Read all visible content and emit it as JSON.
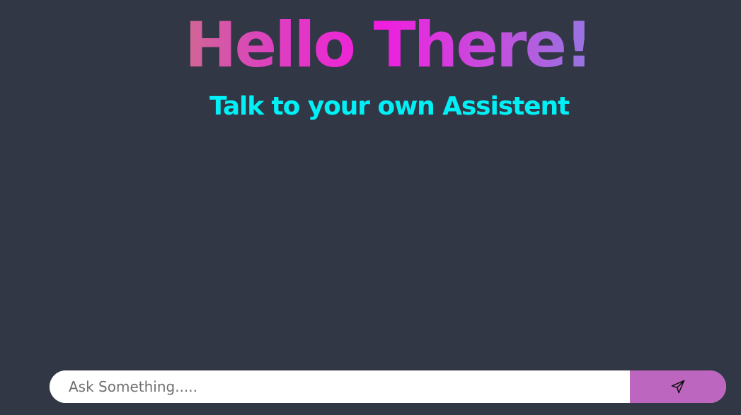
{
  "hero": {
    "title": "Hello There!",
    "subtitle": "Talk to your own Assistent"
  },
  "chat_input": {
    "placeholder": "Ask Something.....",
    "value": ""
  },
  "send_button": {
    "icon": "send-icon"
  },
  "colors": {
    "background": "#313744",
    "title_gradient": [
      "#cd6f8a",
      "#dc43bd",
      "#f11dde",
      "#c84bdd",
      "#8f7ce2"
    ],
    "subtitle": "#00f0f6",
    "input_background": "#ffffff",
    "send_button": "#bd66bf"
  }
}
